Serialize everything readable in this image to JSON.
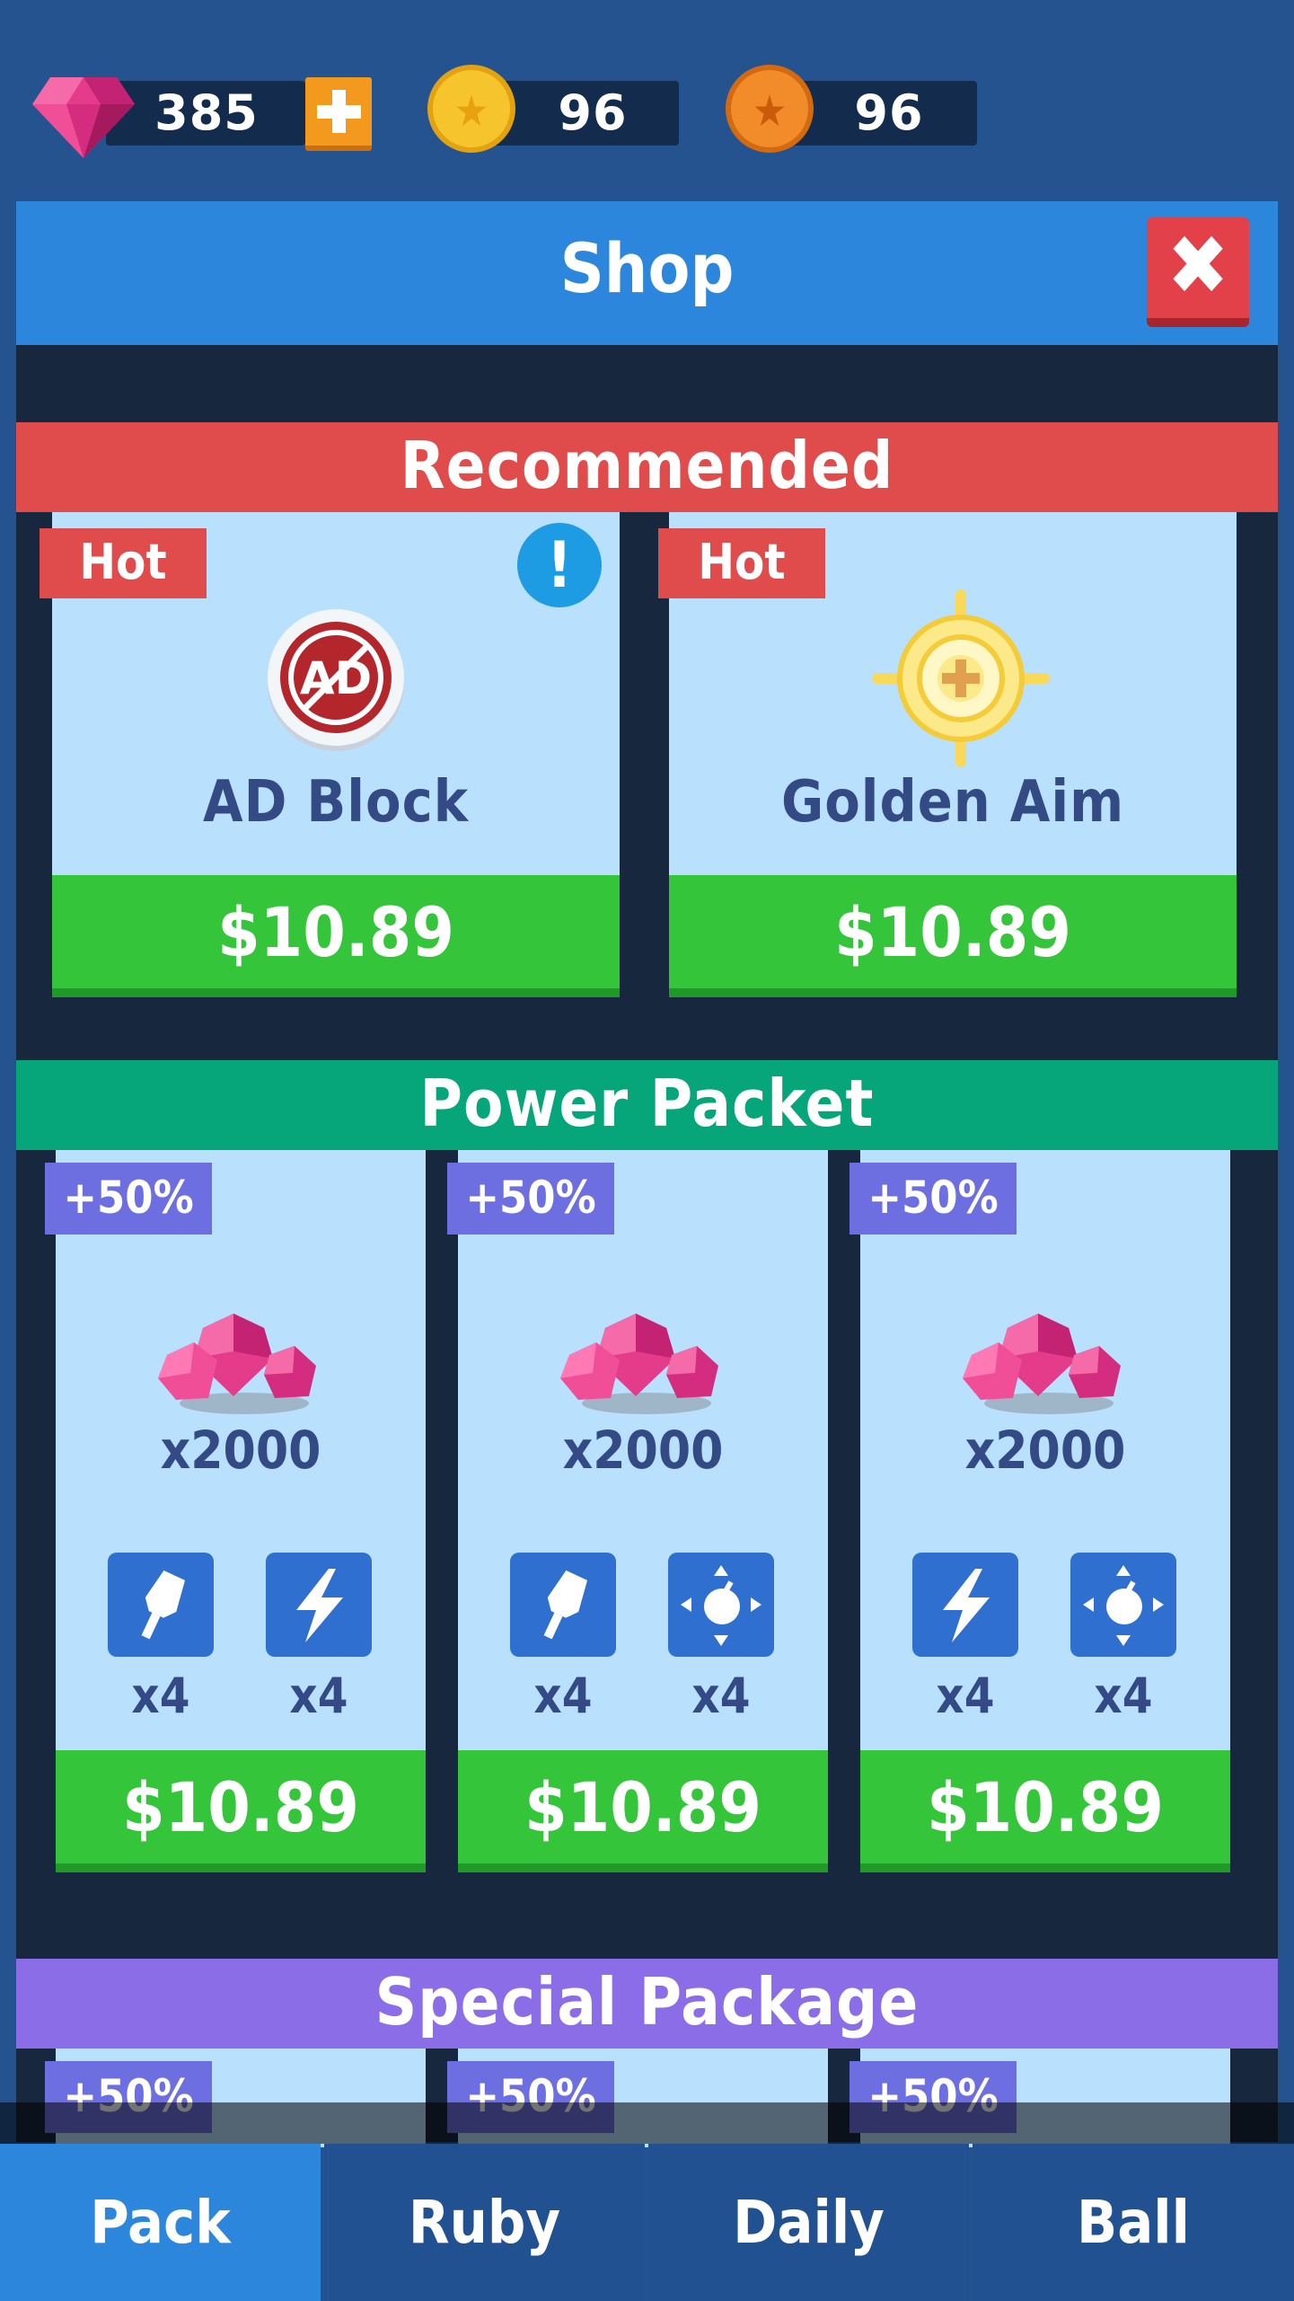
{
  "currencies": {
    "gems": {
      "value": "385",
      "icon": "ruby-gem-icon"
    },
    "gold_coins": {
      "value": "96",
      "icon": "gold-star-coin-icon"
    },
    "bronze_coins": {
      "value": "96",
      "icon": "bronze-star-coin-icon"
    }
  },
  "shop": {
    "title": "Shop",
    "close_icon": "close-icon"
  },
  "recommended": {
    "title": "Recommended",
    "color": "#e04b4c",
    "items": [
      {
        "tag": "Hot",
        "name": "AD Block",
        "price": "$10.89",
        "icon": "ad-block-icon",
        "alert": "!"
      },
      {
        "tag": "Hot",
        "name": "Golden Aim",
        "price": "$10.89",
        "icon": "golden-crosshair-icon"
      }
    ]
  },
  "power_packet": {
    "title": "Power Packet",
    "color": "#07a67a",
    "items": [
      {
        "tag": "+50%",
        "gems": "x2000",
        "perks": [
          {
            "icon": "rocket-icon",
            "count": "x4"
          },
          {
            "icon": "lightning-icon",
            "count": "x4"
          }
        ],
        "price": "$10.89"
      },
      {
        "tag": "+50%",
        "gems": "x2000",
        "perks": [
          {
            "icon": "rocket-icon",
            "count": "x4"
          },
          {
            "icon": "bomb-spread-icon",
            "count": "x4"
          }
        ],
        "price": "$10.89"
      },
      {
        "tag": "+50%",
        "gems": "x2000",
        "perks": [
          {
            "icon": "lightning-icon",
            "count": "x4"
          },
          {
            "icon": "bomb-spread-icon",
            "count": "x4"
          }
        ],
        "price": "$10.89"
      }
    ]
  },
  "special_package": {
    "title": "Special Package",
    "color": "#8c6de8",
    "tags": [
      "+50%",
      "+50%",
      "+50%"
    ]
  },
  "nav": {
    "tabs": [
      {
        "label": "Pack",
        "active": true
      },
      {
        "label": "Ruby",
        "active": false
      },
      {
        "label": "Daily",
        "active": false
      },
      {
        "label": "Ball",
        "active": false
      }
    ]
  }
}
